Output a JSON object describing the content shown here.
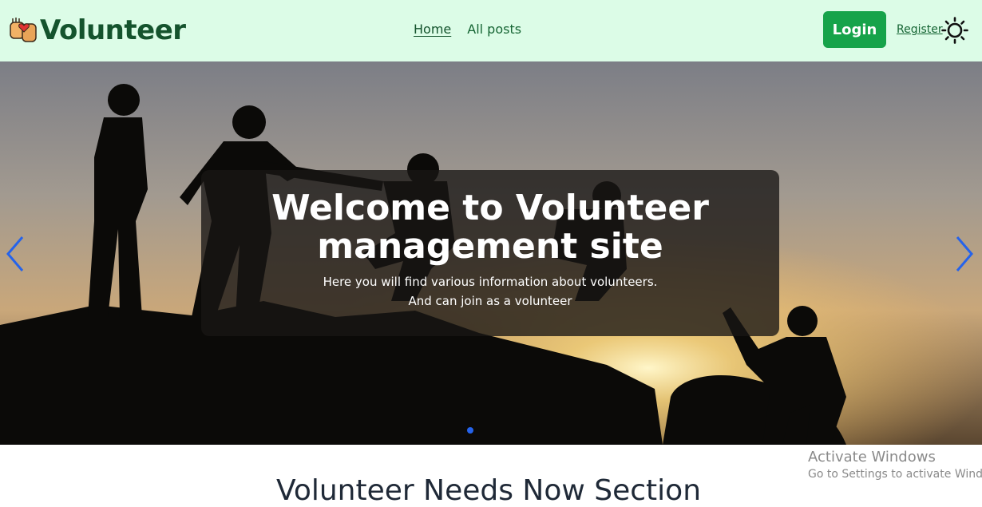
{
  "navbar": {
    "brand": {
      "name": "Volunteer",
      "logo_icon": "helping-hands-heart-icon"
    },
    "links": [
      {
        "label": "Home",
        "active": true
      },
      {
        "label": "All posts",
        "active": false
      }
    ],
    "login_label": "Login",
    "register_label": "Register",
    "theme_icon": "sun-icon"
  },
  "hero": {
    "title": "Welcome to Volunteer management site",
    "subtitle_line1": "Here you will find various information about volunteers.",
    "subtitle_line2": "And can join as a volunteer",
    "prev_icon": "chevron-left-icon",
    "next_icon": "chevron-right-icon",
    "slide_count_dots": 1
  },
  "section": {
    "title": "Volunteer Needs Now Section"
  },
  "os_watermark": {
    "title": "Activate Windows",
    "subtitle": "Go to Settings to activate Windows."
  },
  "colors": {
    "navbar_bg": "#dcfce7",
    "brand_text": "#14532d",
    "login_bg": "#16a34a",
    "nav_link": "#166534",
    "carousel_arrow": "#2563eb"
  }
}
